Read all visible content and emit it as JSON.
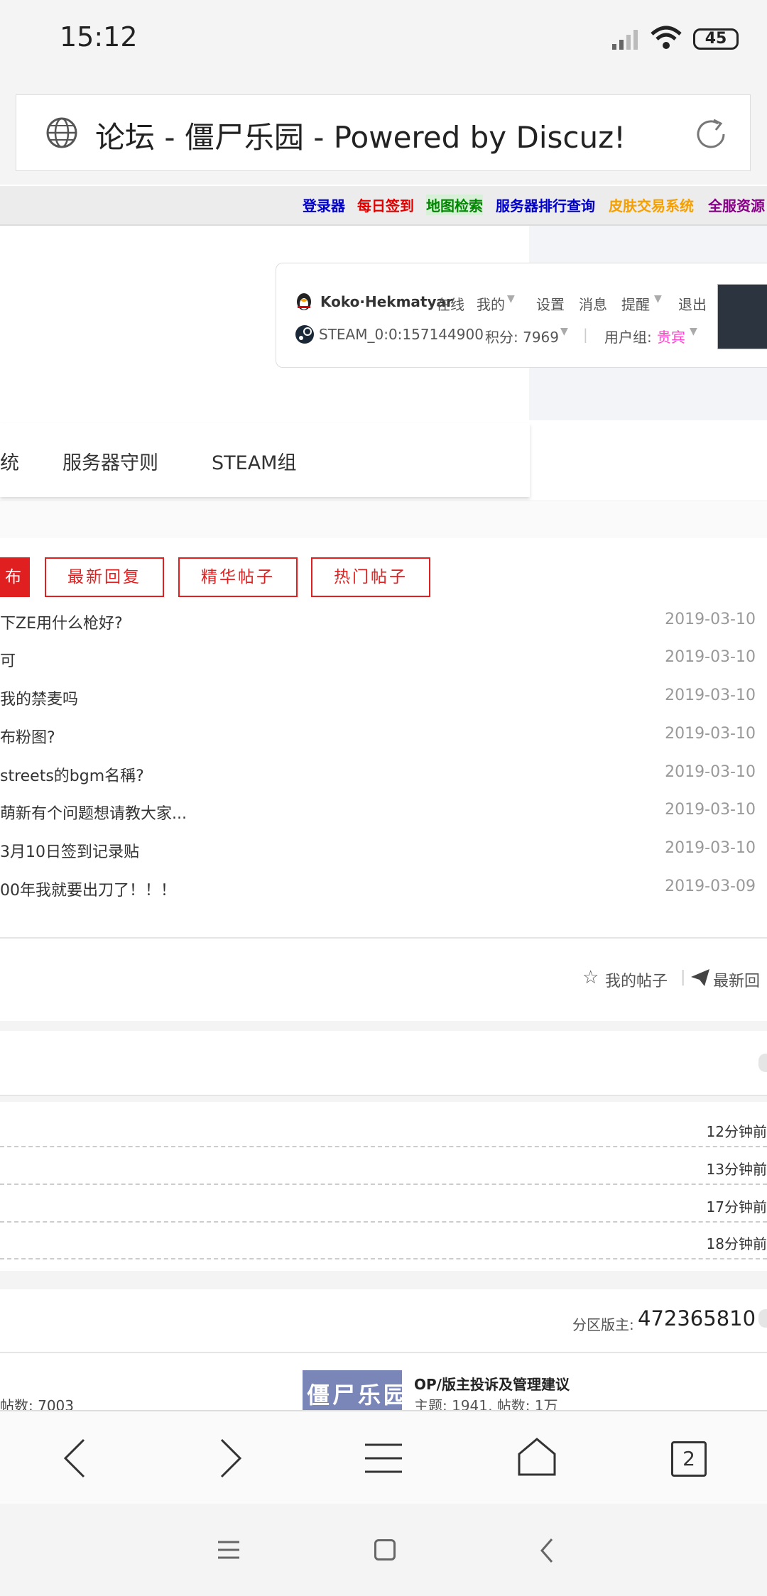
{
  "status_bar": {
    "time": "15:12",
    "battery": "45"
  },
  "address_bar": {
    "title": "论坛 - 僵尸乐园 - Powered by Discuz!"
  },
  "top_links": [
    {
      "label": "登录器",
      "color": "#0000cc"
    },
    {
      "label": "每日签到",
      "color": "#e00000"
    },
    {
      "label": "地图检索",
      "color": "#008800"
    },
    {
      "label": "服务器排行查询",
      "color": "#0000cc"
    },
    {
      "label": "皮肤交易系统",
      "color": "#f5a000"
    },
    {
      "label": "全服资源",
      "color": "#880088"
    }
  ],
  "user": {
    "name": "Koko·Hekmatyar",
    "online": "在线",
    "menu": [
      "我的",
      "设置",
      "消息",
      "提醒",
      "退出"
    ],
    "steam_id": "STEAM_0:0:157144900",
    "points": "积分: 7969",
    "group_label": "用户组:",
    "group_value": "贵宾"
  },
  "nav": {
    "items": [
      "统",
      "服务器守则",
      "STEAM组"
    ]
  },
  "thread_tabs": [
    "布",
    "最新回复",
    "精华帖子",
    "热门帖子"
  ],
  "threads": [
    {
      "title": "下ZE用什么枪好?",
      "date": "2019-03-10"
    },
    {
      "title": "可",
      "date": "2019-03-10"
    },
    {
      "title": "我的禁麦吗",
      "date": "2019-03-10"
    },
    {
      "title": "布粉图?",
      "date": "2019-03-10"
    },
    {
      "title": "streets的bgm名稱?",
      "date": "2019-03-10"
    },
    {
      "title": "萌新有个问题想请教大家...",
      "date": "2019-03-10"
    },
    {
      "title": "3月10日签到记录贴",
      "date": "2019-03-10"
    },
    {
      "title": "00年我就要出刀了！！！",
      "date": "2019-03-09"
    }
  ],
  "my_links": {
    "my_posts": "我的帖子",
    "latest": "最新回"
  },
  "recent_times": [
    "12分钟前",
    "13分钟前",
    "17分钟前",
    "18分钟前"
  ],
  "section": {
    "moderator_label": "分区版主:",
    "moderator_value": "472365810"
  },
  "forum": {
    "left_stats": "帖数: 7003",
    "logo_text": "僵尸乐园",
    "name": "OP/版主投诉及管理建议",
    "stats": "主题: 1941, 帖数: 1万"
  },
  "browser_bar": {
    "tab_count": "2"
  }
}
